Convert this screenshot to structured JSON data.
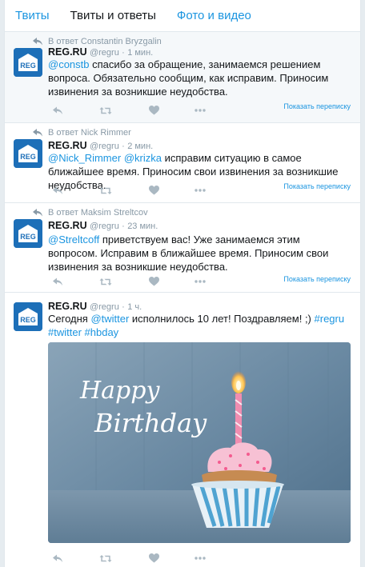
{
  "tabs": [
    "Твиты",
    "Твиты и ответы",
    "Фото и видео"
  ],
  "colors": {
    "accent": "#1b95e0",
    "brand": "#1d6fb8",
    "muted": "#8899a6",
    "action": "#aab8c2"
  },
  "account": {
    "name": "REG.RU",
    "handle": "@regru",
    "avatar_text": "REG"
  },
  "tweets": [
    {
      "reply_to": "В ответ Constantin Bryzgalin",
      "time": "1 мин.",
      "mention": "@constb",
      "text": " спасибо за обращение, занимаемся решением вопроса. Обязательно сообщим, как исправим. Приносим извинения за возникшие неудобства.",
      "show_conversation": "Показать переписку"
    },
    {
      "reply_to": "В ответ Nick Rimmer",
      "time": "2 мин.",
      "mention": "@Nick_Rimmer",
      "mention2": "@krizka",
      "text": " исправим ситуацию в самое ближайшее время. Приносим свои извинения за возникшие неудобства.",
      "show_conversation": "Показать переписку"
    },
    {
      "reply_to": "В ответ Maksim Streltcov",
      "time": "23 мин.",
      "mention": "@Streltcoff",
      "text": " приветствуем вас! Уже занимаемся этим вопросом. Исправим в ближайшее время. Приносим свои извинения за возникшие неудобства.",
      "show_conversation": "Показать переписку"
    },
    {
      "time": "1 ч.",
      "text_a": "Сегодня ",
      "mention": "@twitter",
      "text_b": " исполнилось 10 лет! Поздравляем! ;) ",
      "hashtag1": "#regru",
      "hashtag2": "#twitter",
      "hashtag3": "#hbday",
      "photo_text_1": "Happy",
      "photo_text_2": "Birthday"
    }
  ]
}
